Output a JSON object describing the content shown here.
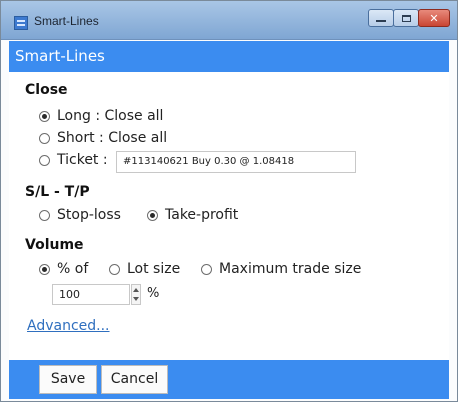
{
  "window": {
    "title": "Smart-Lines"
  },
  "header": {
    "title": "Smart-Lines"
  },
  "close_section": {
    "heading": "Close",
    "options": [
      {
        "label": "Long : Close all",
        "checked": true
      },
      {
        "label": "Short : Close all",
        "checked": false
      },
      {
        "label": "Ticket :",
        "checked": false
      }
    ],
    "ticket_value": "#113140621 Buy 0.30 @ 1.08418"
  },
  "sltp_section": {
    "heading": "S/L - T/P",
    "options": [
      {
        "label": "Stop-loss",
        "checked": false
      },
      {
        "label": "Take-profit",
        "checked": true
      }
    ]
  },
  "volume_section": {
    "heading": "Volume",
    "options": [
      {
        "label": "% of",
        "checked": true
      },
      {
        "label": "Lot size",
        "checked": false
      },
      {
        "label": "Maximum trade size",
        "checked": false
      }
    ],
    "amount": "100",
    "unit": "%"
  },
  "advanced_link": "Advanced...",
  "buttons": {
    "save": "Save",
    "cancel": "Cancel"
  },
  "colors": {
    "accent": "#3b8cf0",
    "link": "#2f6fbf"
  }
}
